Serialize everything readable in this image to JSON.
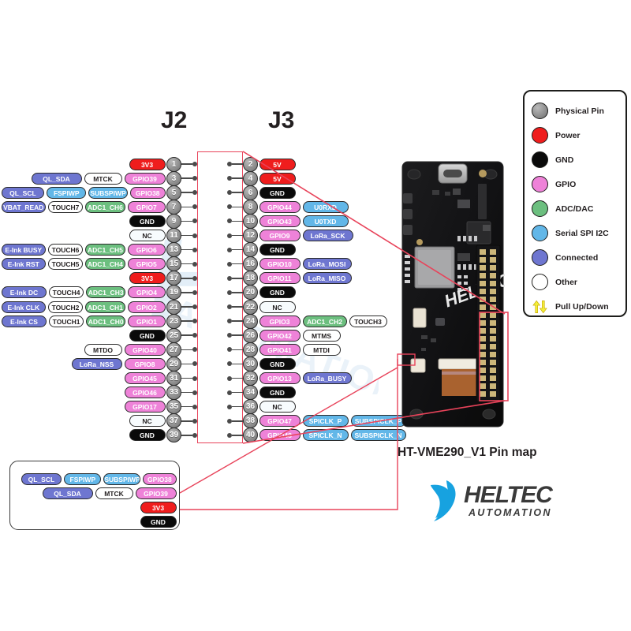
{
  "title": "HT-VME290_V1 Pin map",
  "logo": {
    "name": "HELTEC",
    "sub": "AUTOMATION"
  },
  "watermark": {
    "big": "H",
    "sub": "AUTOMATION"
  },
  "headers": {
    "j2": "J2",
    "j3": "J3"
  },
  "colors": {
    "physical_pin": "#8d8d8d",
    "power": "#ef1d1d",
    "gnd": "#0a0a0a",
    "gpio": "#ee82d8",
    "adc_dac": "#6cbf7f",
    "serial": "#62b7e8",
    "connected": "#6e76d0",
    "other": "#ffffff",
    "pull": "#f2ef3a",
    "callout": "#e8435a"
  },
  "legend": {
    "items": [
      {
        "label": "Physical Pin",
        "type": "physical_pin"
      },
      {
        "label": "Power",
        "type": "power"
      },
      {
        "label": "GND",
        "type": "gnd"
      },
      {
        "label": "GPIO",
        "type": "gpio"
      },
      {
        "label": "ADC/DAC",
        "type": "adc_dac"
      },
      {
        "label": "Serial SPI I2C",
        "type": "serial"
      },
      {
        "label": "Connected",
        "type": "connected"
      },
      {
        "label": "Other",
        "type": "other"
      },
      {
        "label": "Pull Up/Down",
        "type": "pull"
      }
    ]
  },
  "j2": {
    "name": "J2",
    "rows": [
      {
        "pin": "1",
        "tags": [
          {
            "text": "3V3",
            "type": "pwr"
          }
        ]
      },
      {
        "pin": "3",
        "tags": [
          {
            "text": "QL_SDA",
            "type": "conn"
          },
          {
            "text": "MTCK",
            "type": "other"
          },
          {
            "text": "GPIO39",
            "type": "gpio"
          }
        ]
      },
      {
        "pin": "5",
        "tags": [
          {
            "text": "QL_SCL",
            "type": "conn"
          },
          {
            "text": "FSPIWP",
            "type": "spi"
          },
          {
            "text": "SUBSPIWP",
            "type": "spi"
          },
          {
            "text": "GPIO38",
            "type": "gpio"
          }
        ]
      },
      {
        "pin": "7",
        "tags": [
          {
            "text": "VBAT_READ",
            "type": "conn"
          },
          {
            "text": "TOUCH7",
            "type": "other"
          },
          {
            "text": "ADC1_CH6",
            "type": "adc"
          },
          {
            "text": "GPIO7",
            "type": "gpio"
          }
        ]
      },
      {
        "pin": "9",
        "tags": [
          {
            "text": "GND",
            "type": "gnd"
          }
        ]
      },
      {
        "pin": "11",
        "tags": [
          {
            "text": "NC",
            "type": "nc"
          }
        ]
      },
      {
        "pin": "13",
        "tags": [
          {
            "text": "E-Ink BUSY",
            "type": "conn"
          },
          {
            "text": "TOUCH6",
            "type": "other"
          },
          {
            "text": "ADC1_CH5",
            "type": "adc"
          },
          {
            "text": "GPIO6",
            "type": "gpio"
          }
        ]
      },
      {
        "pin": "15",
        "tags": [
          {
            "text": "E-Ink RST",
            "type": "conn"
          },
          {
            "text": "TOUCH5",
            "type": "other"
          },
          {
            "text": "ADC1_CH4",
            "type": "adc"
          },
          {
            "text": "GPIO5",
            "type": "gpio"
          }
        ]
      },
      {
        "pin": "17",
        "tags": [
          {
            "text": "3V3",
            "type": "pwr"
          }
        ]
      },
      {
        "pin": "19",
        "tags": [
          {
            "text": "E-Ink DC",
            "type": "conn"
          },
          {
            "text": "TOUCH4",
            "type": "other"
          },
          {
            "text": "ADC1_CH3",
            "type": "adc"
          },
          {
            "text": "GPIO4",
            "type": "gpio"
          }
        ]
      },
      {
        "pin": "21",
        "tags": [
          {
            "text": "E-Ink CLK",
            "type": "conn"
          },
          {
            "text": "TOUCH2",
            "type": "other"
          },
          {
            "text": "ADC1_CH1",
            "type": "adc"
          },
          {
            "text": "GPIO2",
            "type": "gpio"
          }
        ]
      },
      {
        "pin": "23",
        "tags": [
          {
            "text": "E-Ink CS",
            "type": "conn"
          },
          {
            "text": "TOUCH1",
            "type": "other"
          },
          {
            "text": "ADC1_CH0",
            "type": "adc"
          },
          {
            "text": "GPIO1",
            "type": "gpio"
          }
        ]
      },
      {
        "pin": "25",
        "tags": [
          {
            "text": "GND",
            "type": "gnd"
          }
        ]
      },
      {
        "pin": "27",
        "tags": [
          {
            "text": "MTDO",
            "type": "other"
          },
          {
            "text": "GPIO40",
            "type": "gpio"
          }
        ]
      },
      {
        "pin": "29",
        "tags": [
          {
            "text": "LoRa_NSS",
            "type": "conn"
          },
          {
            "text": "GPIO8",
            "type": "gpio"
          }
        ]
      },
      {
        "pin": "31",
        "tags": [
          {
            "text": "GPIO45",
            "type": "gpio"
          }
        ]
      },
      {
        "pin": "33",
        "tags": [
          {
            "text": "GPIO46",
            "type": "gpio"
          }
        ]
      },
      {
        "pin": "35",
        "tags": [
          {
            "text": "GPIO17",
            "type": "gpio"
          }
        ]
      },
      {
        "pin": "37",
        "tags": [
          {
            "text": "NC",
            "type": "nc"
          }
        ]
      },
      {
        "pin": "39",
        "tags": [
          {
            "text": "GND",
            "type": "gnd"
          }
        ]
      }
    ]
  },
  "j3": {
    "name": "J3",
    "rows": [
      {
        "pin": "2",
        "tags": [
          {
            "text": "5V",
            "type": "pwr"
          }
        ]
      },
      {
        "pin": "4",
        "tags": [
          {
            "text": "5V",
            "type": "pwr"
          }
        ]
      },
      {
        "pin": "6",
        "tags": [
          {
            "text": "GND",
            "type": "gnd"
          }
        ]
      },
      {
        "pin": "8",
        "tags": [
          {
            "text": "GPIO44",
            "type": "gpio"
          },
          {
            "text": "U0RXD",
            "type": "spi"
          }
        ]
      },
      {
        "pin": "10",
        "tags": [
          {
            "text": "GPIO43",
            "type": "gpio"
          },
          {
            "text": "U0TXD",
            "type": "spi"
          }
        ]
      },
      {
        "pin": "12",
        "tags": [
          {
            "text": "GPIO9",
            "type": "gpio"
          },
          {
            "text": "LoRa_SCK",
            "type": "conn"
          }
        ]
      },
      {
        "pin": "14",
        "tags": [
          {
            "text": "GND",
            "type": "gnd"
          }
        ]
      },
      {
        "pin": "16",
        "tags": [
          {
            "text": "GPIO10",
            "type": "gpio"
          },
          {
            "text": "LoRa_MOSI",
            "type": "conn"
          }
        ]
      },
      {
        "pin": "18",
        "tags": [
          {
            "text": "GPIO11",
            "type": "gpio"
          },
          {
            "text": "LoRa_MISO",
            "type": "conn"
          }
        ]
      },
      {
        "pin": "20",
        "tags": [
          {
            "text": "GND",
            "type": "gnd"
          }
        ]
      },
      {
        "pin": "22",
        "tags": [
          {
            "text": "NC",
            "type": "nc"
          }
        ]
      },
      {
        "pin": "24",
        "tags": [
          {
            "text": "GPIO3",
            "type": "gpio"
          },
          {
            "text": "ADC1_CH2",
            "type": "adc"
          },
          {
            "text": "TOUCH3",
            "type": "other"
          }
        ]
      },
      {
        "pin": "26",
        "tags": [
          {
            "text": "GPIO42",
            "type": "gpio"
          },
          {
            "text": "MTMS",
            "type": "other"
          }
        ]
      },
      {
        "pin": "28",
        "tags": [
          {
            "text": "GPIO41",
            "type": "gpio"
          },
          {
            "text": "MTDI",
            "type": "other"
          }
        ]
      },
      {
        "pin": "30",
        "tags": [
          {
            "text": "GND",
            "type": "gnd"
          }
        ]
      },
      {
        "pin": "32",
        "tags": [
          {
            "text": "GPIO13",
            "type": "gpio"
          },
          {
            "text": "LoRa_BUSY",
            "type": "conn"
          }
        ]
      },
      {
        "pin": "34",
        "tags": [
          {
            "text": "GND",
            "type": "gnd"
          }
        ]
      },
      {
        "pin": "36",
        "tags": [
          {
            "text": "NC",
            "type": "nc"
          }
        ]
      },
      {
        "pin": "38",
        "tags": [
          {
            "text": "GPIO47",
            "type": "gpio"
          },
          {
            "text": "SPICLK_P",
            "type": "spi"
          },
          {
            "text": "SUBSPICLK_P",
            "type": "spi"
          }
        ]
      },
      {
        "pin": "40",
        "tags": [
          {
            "text": "GPIO48",
            "type": "gpio"
          },
          {
            "text": "SPICLK_N",
            "type": "spi"
          },
          {
            "text": "SUBSPICLK_N",
            "type": "spi"
          }
        ]
      }
    ]
  },
  "inset": {
    "rows": [
      {
        "tags": [
          {
            "text": "QL_SCL",
            "type": "conn"
          },
          {
            "text": "FSPIWP",
            "type": "spi"
          },
          {
            "text": "SUBSPIWP",
            "type": "spi"
          },
          {
            "text": "GPIO38",
            "type": "gpio"
          }
        ]
      },
      {
        "tags": [
          {
            "text": "QL_SDA",
            "type": "conn"
          },
          {
            "text": "MTCK",
            "type": "other"
          },
          {
            "text": "GPIO39",
            "type": "gpio"
          }
        ]
      },
      {
        "tags": [
          {
            "text": "3V3",
            "type": "pwr"
          }
        ]
      },
      {
        "tags": [
          {
            "text": "GND",
            "type": "gnd"
          }
        ]
      }
    ]
  }
}
